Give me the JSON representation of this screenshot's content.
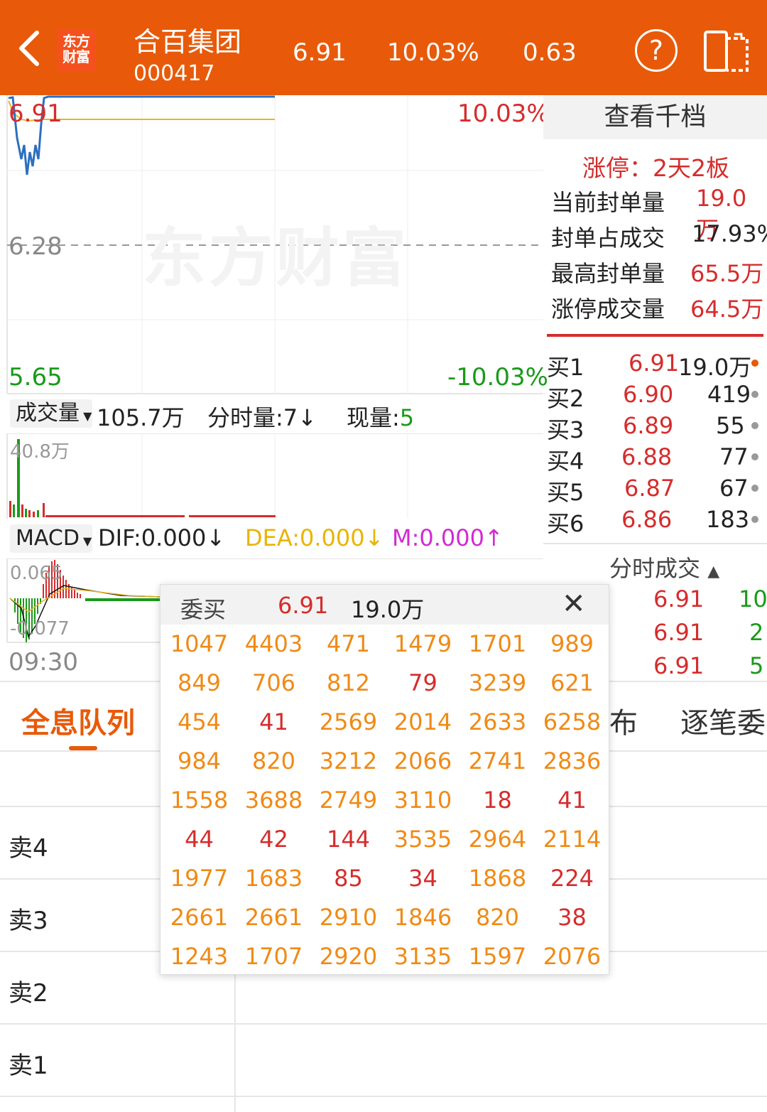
{
  "header": {
    "logo_text": "东方财富",
    "stock_name": "合百集团",
    "stock_code": "000417",
    "price": "6.91",
    "change_pct": "10.03%",
    "change_amt": "0.63",
    "help_symbol": "?"
  },
  "chart": {
    "price_high": "6.91",
    "pct_high": "10.03%",
    "price_mid": "6.28",
    "price_low": "5.65",
    "pct_low": "-10.03%",
    "watermark": "东方财富",
    "volume_selector": "成交量",
    "volume_total": "105.7万",
    "fen_shi_label": "分时量:7",
    "xian_liang_label": "现量:",
    "xian_liang_value": "5",
    "volume_max": "40.8万",
    "macd_selector": "MACD",
    "dif": "DIF:0.000",
    "dea": "DEA:0.000",
    "m": "M:0.000",
    "macd_high": "0.065",
    "macd_low": "-0.077",
    "time_start": "09:30"
  },
  "right_panel": {
    "qiandang_button": "查看千档",
    "limit_up_label": "涨停：2天2板",
    "stats": [
      {
        "label": "当前封单量",
        "value": "19.0万"
      },
      {
        "label": "封单占成交",
        "value": "17.93%"
      },
      {
        "label": "最高封单量",
        "value": "65.5万"
      },
      {
        "label": "涨停成交量",
        "value": "64.5万"
      }
    ],
    "bids": [
      {
        "label": "买1",
        "price": "6.91",
        "volume": "19.0万"
      },
      {
        "label": "买2",
        "price": "6.90",
        "volume": "419"
      },
      {
        "label": "买3",
        "price": "6.89",
        "volume": "55"
      },
      {
        "label": "买4",
        "price": "6.88",
        "volume": "77"
      },
      {
        "label": "买5",
        "price": "6.87",
        "volume": "67"
      },
      {
        "label": "买6",
        "price": "6.86",
        "volume": "183"
      }
    ],
    "fenshi_chengjiao": "分时成交",
    "trades": [
      {
        "price": "6.91",
        "volume": "10"
      },
      {
        "price": "6.91",
        "volume": "2"
      },
      {
        "price": "6.91",
        "volume": "5"
      }
    ]
  },
  "tabs": {
    "active": "全息队列",
    "partial_1": "布",
    "partial_2": "逐笔委"
  },
  "sell_rows": [
    "卖4",
    "卖3",
    "卖2",
    "卖1"
  ],
  "popup": {
    "title": "委买",
    "price": "6.91",
    "volume": "19.0万",
    "close_symbol": "✕",
    "orders": [
      [
        "1047",
        "4403",
        "471",
        "1479",
        "1701",
        "989"
      ],
      [
        "849",
        "706",
        "812",
        "79",
        "3239",
        "621"
      ],
      [
        "454",
        "41",
        "2569",
        "2014",
        "2633",
        "6258"
      ],
      [
        "984",
        "820",
        "3212",
        "2066",
        "2741",
        "2836"
      ],
      [
        "1558",
        "3688",
        "2749",
        "3110",
        "18",
        "41"
      ],
      [
        "44",
        "42",
        "144",
        "3535",
        "2964",
        "2114"
      ],
      [
        "1977",
        "1683",
        "85",
        "34",
        "1868",
        "224"
      ],
      [
        "2661",
        "2661",
        "2910",
        "1846",
        "820",
        "38"
      ],
      [
        "1243",
        "1707",
        "2920",
        "3135",
        "1597",
        "2076"
      ]
    ],
    "order_colors": [
      [
        "o",
        "o",
        "o",
        "o",
        "o",
        "o"
      ],
      [
        "o",
        "o",
        "o",
        "r",
        "o",
        "o"
      ],
      [
        "o",
        "r",
        "o",
        "o",
        "o",
        "o"
      ],
      [
        "o",
        "o",
        "o",
        "o",
        "o",
        "o"
      ],
      [
        "o",
        "o",
        "o",
        "o",
        "r",
        "r"
      ],
      [
        "r",
        "r",
        "r",
        "o",
        "o",
        "o"
      ],
      [
        "o",
        "o",
        "r",
        "r",
        "o",
        "r"
      ],
      [
        "o",
        "o",
        "o",
        "o",
        "o",
        "r"
      ],
      [
        "o",
        "o",
        "o",
        "o",
        "o",
        "o"
      ]
    ]
  }
}
